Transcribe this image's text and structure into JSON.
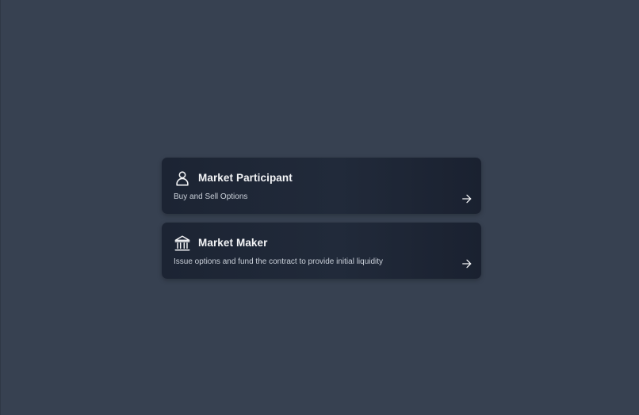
{
  "roles": [
    {
      "title": "Market Participant",
      "description": "Buy and Sell Options",
      "icon": "user-icon"
    },
    {
      "title": "Market Maker",
      "description": "Issue options and fund the contract to provide initial liquidity",
      "icon": "bank-icon"
    }
  ],
  "colors": {
    "background": "#374151",
    "card": "#1f2737",
    "title": "#f3f4f6",
    "description": "#cbd1da"
  },
  "arrow_icon": "arrow-right-icon"
}
